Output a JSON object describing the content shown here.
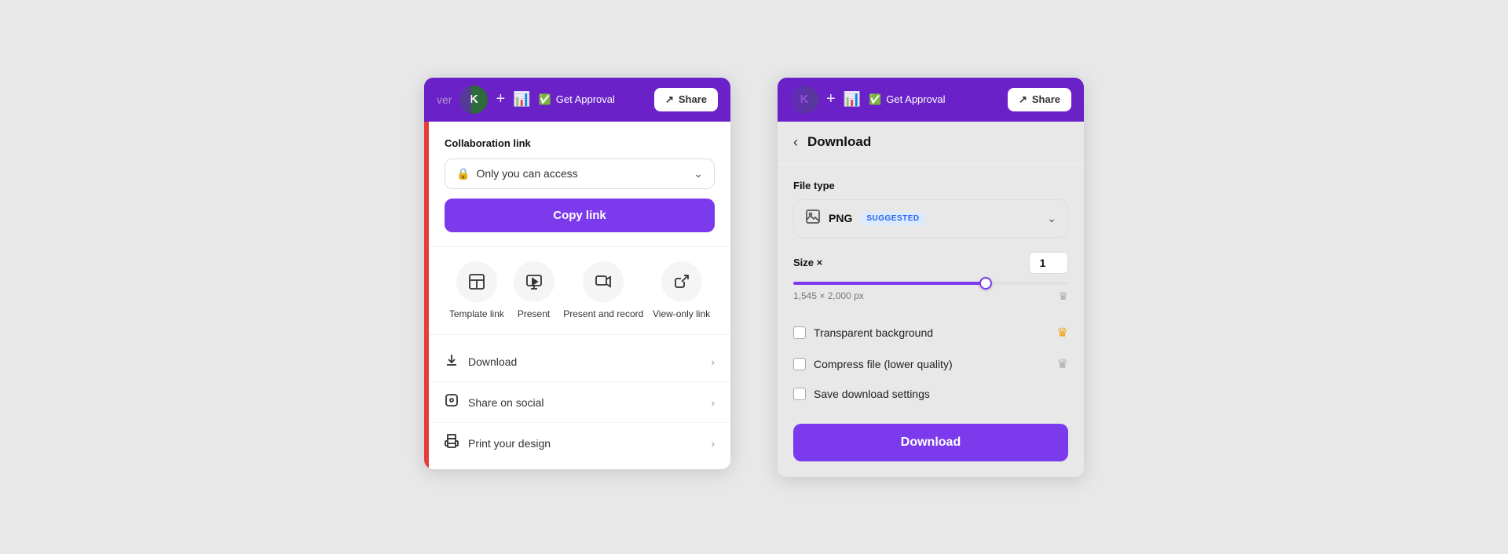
{
  "leftPanel": {
    "topBar": {
      "fadeText": "ver",
      "avatarInitial": "K",
      "plusLabel": "+",
      "chartLabel": "📊",
      "getApprovalLabel": "Get Approval",
      "shareLabel": "Share"
    },
    "collabSection": {
      "title": "Collaboration link",
      "accessLabel": "Only you can access",
      "copyBtnLabel": "Copy link"
    },
    "shareGrid": {
      "items": [
        {
          "id": "template-link",
          "iconUnicode": "⊞",
          "label": "Template link"
        },
        {
          "id": "present",
          "iconUnicode": "🖥",
          "label": "Present"
        },
        {
          "id": "present-record",
          "iconUnicode": "🎥",
          "label": "Present and record"
        },
        {
          "id": "view-only",
          "iconUnicode": "🔗",
          "label": "View-only link"
        }
      ]
    },
    "actionList": {
      "items": [
        {
          "id": "download",
          "iconUnicode": "⬇",
          "label": "Download"
        },
        {
          "id": "share-social",
          "iconUnicode": "♡",
          "label": "Share on social"
        },
        {
          "id": "print",
          "iconUnicode": "🖨",
          "label": "Print your design"
        }
      ]
    }
  },
  "rightPanel": {
    "topBar": {
      "avatarInitial": "K",
      "plusLabel": "+",
      "getApprovalLabel": "Get Approval",
      "shareLabel": "Share"
    },
    "header": {
      "backLabel": "‹",
      "title": "Download"
    },
    "fileTypeSection": {
      "label": "File type",
      "typeName": "PNG",
      "badgeLabel": "SUGGESTED"
    },
    "sizeSection": {
      "label": "Size ×",
      "inputValue": "1",
      "dimensions": "1,545 × 2,000 px",
      "sliderPercent": 70
    },
    "options": [
      {
        "id": "transparent",
        "label": "Transparent background",
        "hasCrown": true,
        "crownColor": "gold"
      },
      {
        "id": "compress",
        "label": "Compress file (lower quality)",
        "hasCrown": true,
        "crownColor": "gray"
      },
      {
        "id": "save-settings",
        "label": "Save download settings",
        "hasCrown": false
      }
    ],
    "downloadBtnLabel": "Download"
  }
}
